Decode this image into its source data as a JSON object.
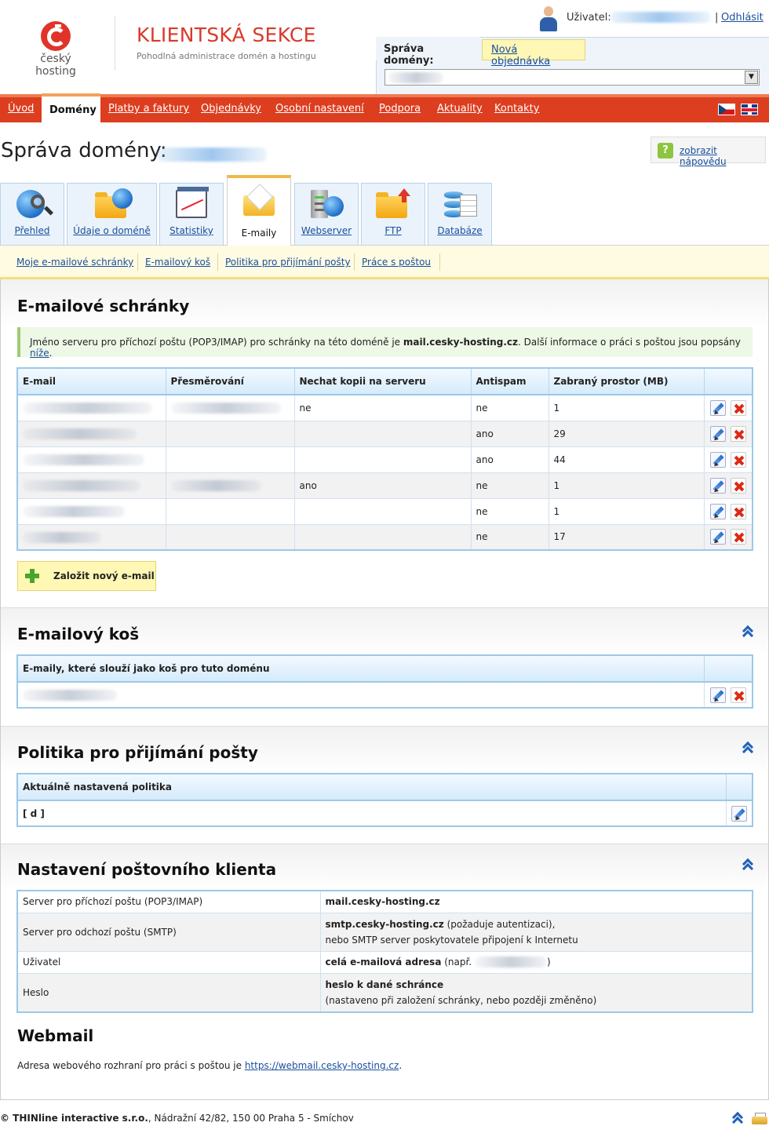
{
  "header": {
    "logo_text": "český hosting",
    "brand_title": "KLIENTSKÁ SEKCE",
    "brand_subtitle": "Pohodlná administrace domén a hostingu",
    "user_label": "Uživatel:",
    "logout_separator": "|",
    "logout": "Odhlásit",
    "domain_tab": "Správa domény:",
    "new_order_tab": "Nová objednávka",
    "select_arrow": "▼"
  },
  "nav": {
    "items": [
      "Úvod",
      "Domény",
      "Platby a faktury",
      "Objednávky",
      "Osobní nastavení",
      "Podpora",
      "Aktuality",
      "Kontakty"
    ]
  },
  "page": {
    "title": "Správa domény:",
    "help": "zobrazit nápovědu",
    "help_icon": "?"
  },
  "tabs": [
    "Přehled",
    "Údaje o doméně",
    "Statistiky",
    "E-maily",
    "Webserver",
    "FTP",
    "Databáze"
  ],
  "subnav": [
    "Moje e-mailové schránky",
    "E-mailový koš",
    "Politika pro přijímání pošty",
    "Práce s poštou"
  ],
  "mailboxes": {
    "title": "E-mailové schránky",
    "info_prefix": "Jméno serveru pro příchozí poštu (POP3/IMAP) pro schránky na této doméně je ",
    "info_server": "mail.cesky-hosting.cz",
    "info_middle": ". Další informace o práci s poštou jsou popsány ",
    "info_link": "níže",
    "info_suffix": ".",
    "columns": [
      "E-mail",
      "Přesměrování",
      "Nechat kopii na serveru",
      "Antispam",
      "Zabraný prostor (MB)"
    ],
    "rows": [
      {
        "copy": "ne",
        "antispam": "ne",
        "space": "1"
      },
      {
        "copy": "",
        "antispam": "ano",
        "space": "29"
      },
      {
        "copy": "",
        "antispam": "ano",
        "space": "44"
      },
      {
        "copy": "ano",
        "antispam": "ne",
        "space": "1"
      },
      {
        "copy": "",
        "antispam": "ne",
        "space": "1"
      },
      {
        "copy": "",
        "antispam": "ne",
        "space": "17"
      }
    ],
    "add_button": "Založit nový e-mail"
  },
  "trash": {
    "title": "E-mailový koš",
    "column": "E-maily, které slouží jako koš pro tuto doménu"
  },
  "policy": {
    "title": "Politika pro přijímání pošty",
    "column": "Aktuálně nastavená politika",
    "value": "[ d ]"
  },
  "client": {
    "title": "Nastavení poštovního klienta",
    "incoming_label": "Server pro příchozí poštu (POP3/IMAP)",
    "incoming_value": "mail.cesky-hosting.cz",
    "outgoing_label": "Server pro odchozí poštu (SMTP)",
    "outgoing_value": "smtp.cesky-hosting.cz",
    "outgoing_note": " (požaduje autentizaci),",
    "outgoing_line2": "nebo SMTP server poskytovatele připojení k Internetu",
    "user_label": "Uživatel",
    "user_value": "celá e-mailová adresa",
    "user_note_open": " (např. ",
    "user_note_close": ")",
    "password_label": "Heslo",
    "password_value": "heslo k dané schránce",
    "password_note": "(nastaveno při založení schránky, nebo později změněno)"
  },
  "webmail": {
    "title": "Webmail",
    "text": "Adresa webového rozhraní pro práci s poštou je ",
    "link": "https://webmail.cesky-hosting.cz",
    "suffix": "."
  },
  "footer": {
    "company": "© THINline interactive s.r.o.",
    "address": ", Nádražní 42/82, 150 00 Praha 5 - Smíchov"
  }
}
